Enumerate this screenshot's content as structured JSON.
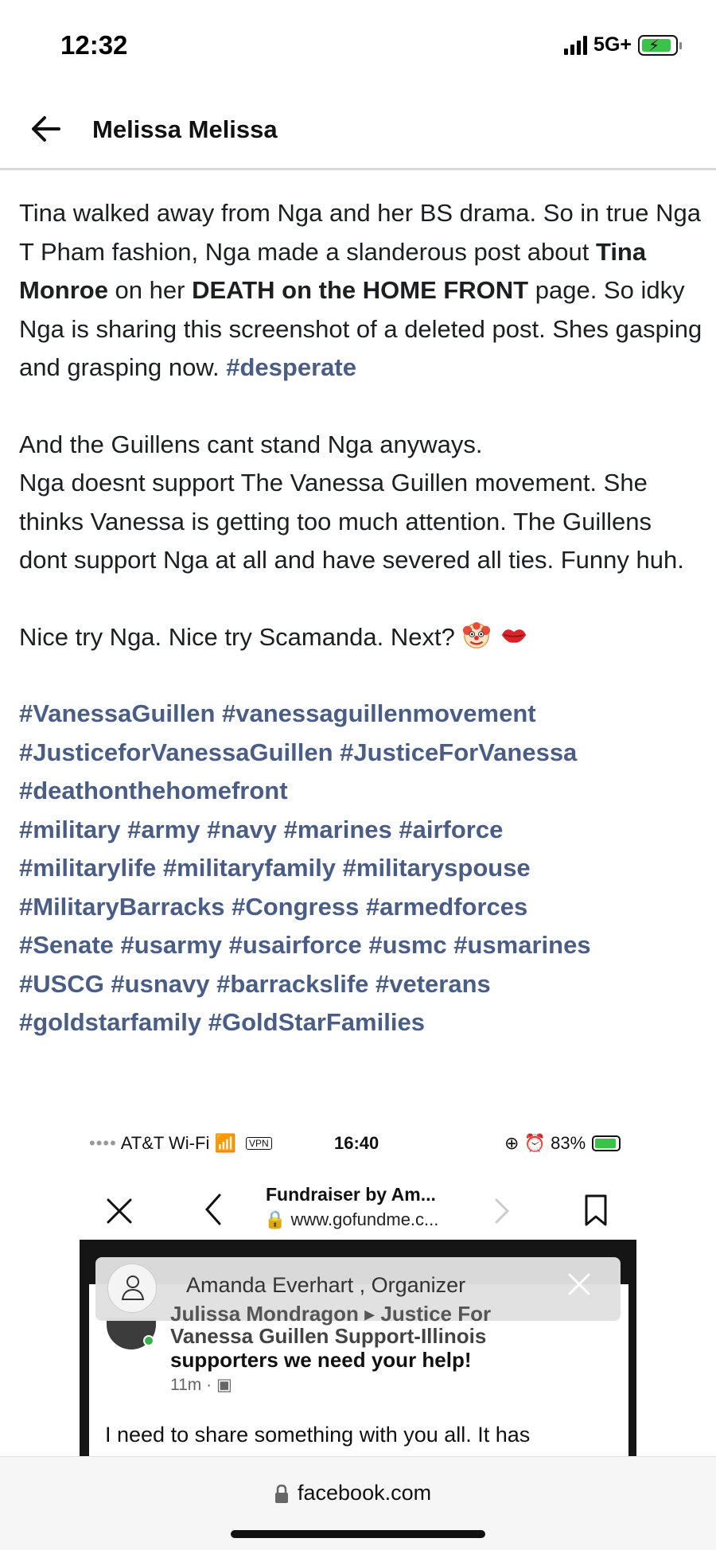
{
  "status_bar": {
    "time": "12:32",
    "network": "5G+",
    "battery_color": "#3ac24a"
  },
  "header": {
    "title": "Melissa Melissa"
  },
  "post": {
    "p1_a": "Tina walked away from Nga and her BS drama. So in true Nga T Pham fashion, Nga made a slanderous post about ",
    "p1_bold1": "Tina Monroe",
    "p1_b": " on her ",
    "p1_bold2": "DEATH on the HOME FRONT",
    "p1_c": " page. So idky Nga is sharing this screenshot of a deleted post. Shes gasping and grasping now. ",
    "p1_tag": "#desperate",
    "p2_l1": "And the Guillens cant stand Nga anyways.",
    "p2_rest": "Nga doesnt support The Vanessa Guillen movement. She thinks Vanessa is getting too much attention. The Guillens dont support Nga at all and have severed all ties. Funny huh.",
    "p3": "Nice try Nga. Nice try Scamanda. Next?",
    "emojis": [
      "clown-face-emoji",
      "kiss-mark-emoji"
    ],
    "hashtags": [
      "#VanessaGuillen #vanessaguillenmovement",
      "#JusticeforVanessaGuillen #JusticeForVanessa",
      "#deathonthehomefront",
      "#military #army #navy #marines #airforce",
      "#militarylife #militaryfamily #militaryspouse",
      "#MilitaryBarracks #Congress #armedforces",
      "#Senate #usarmy #usairforce #usmc #usmarines",
      "#USCG #usnavy #barrackslife #veterans",
      "#goldstarfamily #GoldStarFamilies"
    ],
    "hashtag_color": "#4a5d86"
  },
  "embedded": {
    "carrier": "AT&T Wi-Fi",
    "vpn": "VPN",
    "time": "16:40",
    "battery": "83%",
    "page_title": "Fundraiser by Am...",
    "url": "www.gofundme.c...",
    "banner_name": "Amanda Everhart , Organizer",
    "ghost_line1": "Julissa Mondragon ▸ Justice For",
    "ghost_line2": "Vanessa Guillen Support-Illinois",
    "post_line3": "supporters we need your help!",
    "post_time": "11m · ",
    "post_body": "I need to share something with you all. It has"
  },
  "bottom_bar": {
    "domain": "facebook.com"
  }
}
